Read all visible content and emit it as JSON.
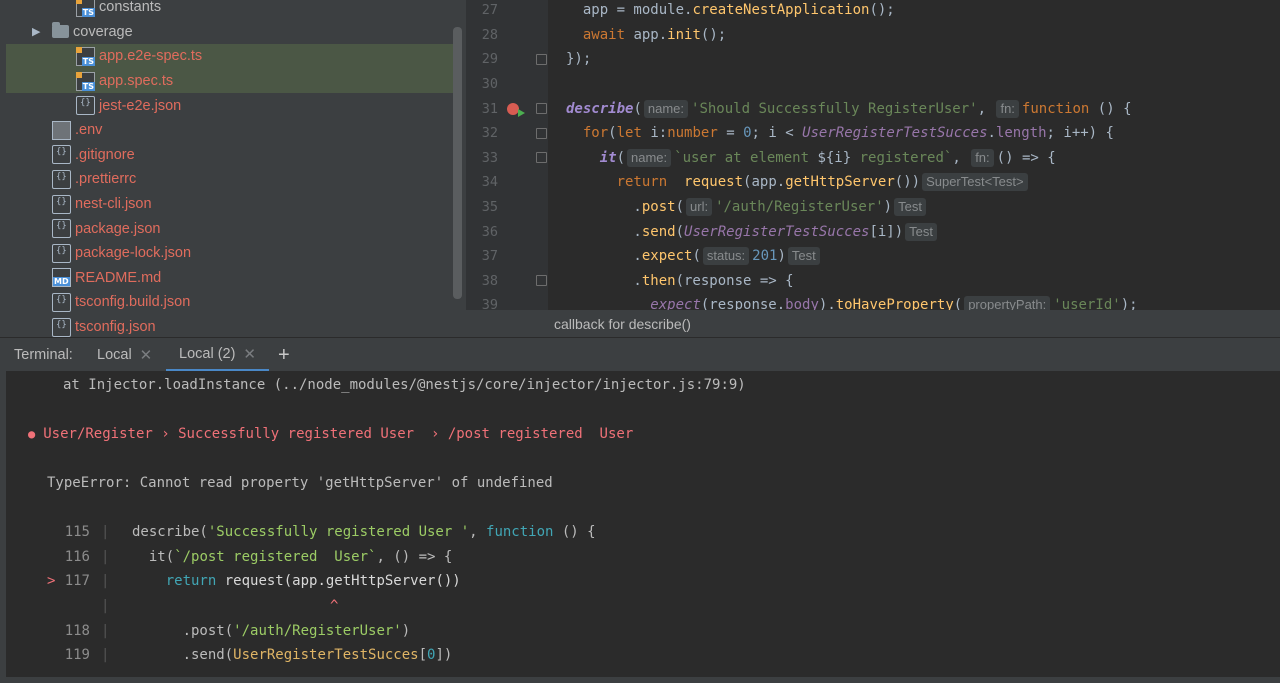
{
  "project_tree": {
    "items": [
      {
        "label": "constants",
        "icon": "ts-file-icon",
        "indent": 3,
        "red": false,
        "partial": true
      },
      {
        "label": "coverage",
        "icon": "folder-icon",
        "indent": 2,
        "red": false,
        "expand": "▶"
      },
      {
        "label": "app.e2e-spec.ts",
        "icon": "ts-file-icon",
        "indent": 3,
        "red": true,
        "selected": true
      },
      {
        "label": "app.spec.ts",
        "icon": "ts-file-icon",
        "indent": 3,
        "red": true,
        "selected": true
      },
      {
        "label": "jest-e2e.json",
        "icon": "json-file-icon",
        "indent": 3,
        "red": true
      },
      {
        "label": ".env",
        "icon": "text-file-icon",
        "indent": 2,
        "red": true
      },
      {
        "label": ".gitignore",
        "icon": "config-file-icon",
        "indent": 2,
        "red": true
      },
      {
        "label": ".prettierrc",
        "icon": "json-file-icon",
        "indent": 2,
        "red": true
      },
      {
        "label": "nest-cli.json",
        "icon": "json-file-icon",
        "indent": 2,
        "red": true
      },
      {
        "label": "package.json",
        "icon": "json-file-icon",
        "indent": 2,
        "red": true
      },
      {
        "label": "package-lock.json",
        "icon": "json-file-icon",
        "indent": 2,
        "red": true
      },
      {
        "label": "README.md",
        "icon": "markdown-file-icon",
        "indent": 2,
        "red": true
      },
      {
        "label": "tsconfig.build.json",
        "icon": "json-file-icon",
        "indent": 2,
        "red": true
      },
      {
        "label": "tsconfig.json",
        "icon": "json-file-icon",
        "indent": 2,
        "red": true
      }
    ]
  },
  "editor": {
    "line_numbers": [
      "27",
      "28",
      "29",
      "30",
      "31",
      "32",
      "33",
      "34",
      "35",
      "36",
      "37",
      "38",
      "39"
    ],
    "breadcrumb": "callback for describe()"
  },
  "terminal": {
    "label": "Terminal:",
    "tabs": [
      {
        "label": "Local",
        "active": false
      },
      {
        "label": "Local (2)",
        "active": true
      }
    ],
    "add_tab": "+",
    "lines": {
      "injector": "at Injector.loadInstance (../node_modules/@nestjs/core/injector/injector.js:79:9)",
      "bullet": "●",
      "failing_test": "User/Register › Successfully registered User  › /post registered  User",
      "error": "TypeError: Cannot read property 'getHttpServer' of undefined",
      "caret": "^",
      "marker": ">"
    },
    "gutter": [
      "115",
      "116",
      "117",
      "118",
      "119"
    ]
  }
}
